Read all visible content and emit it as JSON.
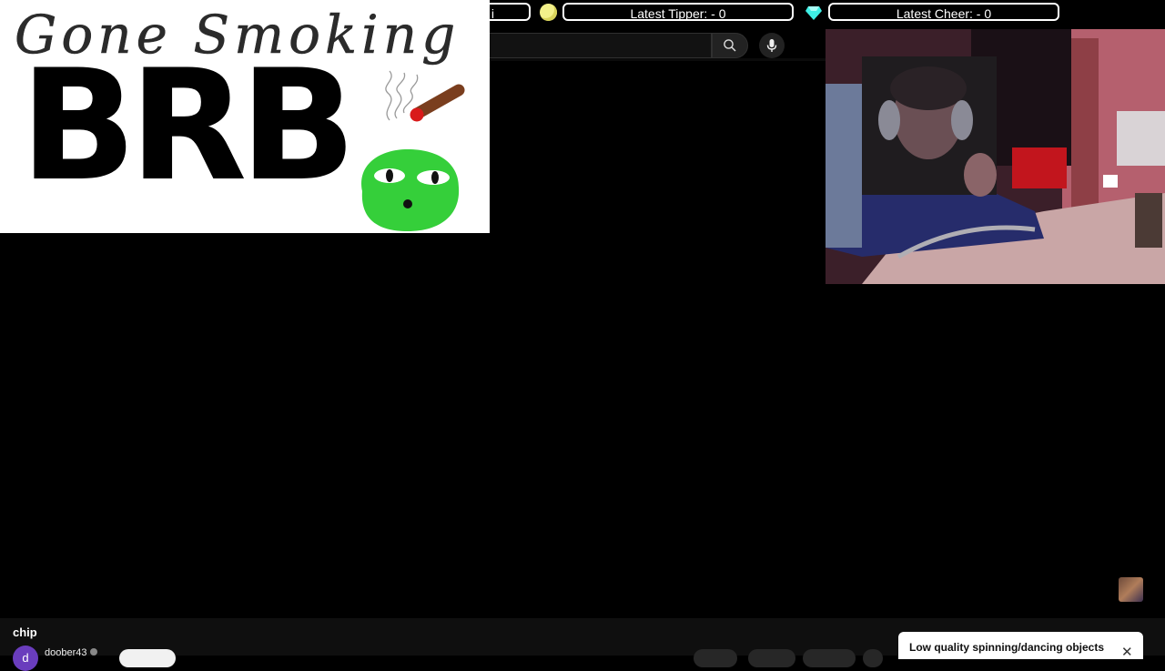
{
  "alerts": {
    "first_pill_fragment": "i",
    "tipper_label": "Latest Tipper: - 0",
    "cheer_label": "Latest Cheer: - 0",
    "coin_color": "#f2f08a",
    "gem_color": "#3ff0e6"
  },
  "brb_overlay": {
    "top_text": "Gone Smoking",
    "main_text": "BRB",
    "blob_color": "#35cf3a"
  },
  "video": {
    "title": "chip",
    "channel_initial": "d",
    "channel_name": "doober43"
  },
  "banner": {
    "text": "Low quality spinning/dancing objects",
    "close_icon": "✕"
  },
  "icons": {
    "search": "search-icon",
    "mic": "microphone-icon",
    "close": "close-icon"
  }
}
